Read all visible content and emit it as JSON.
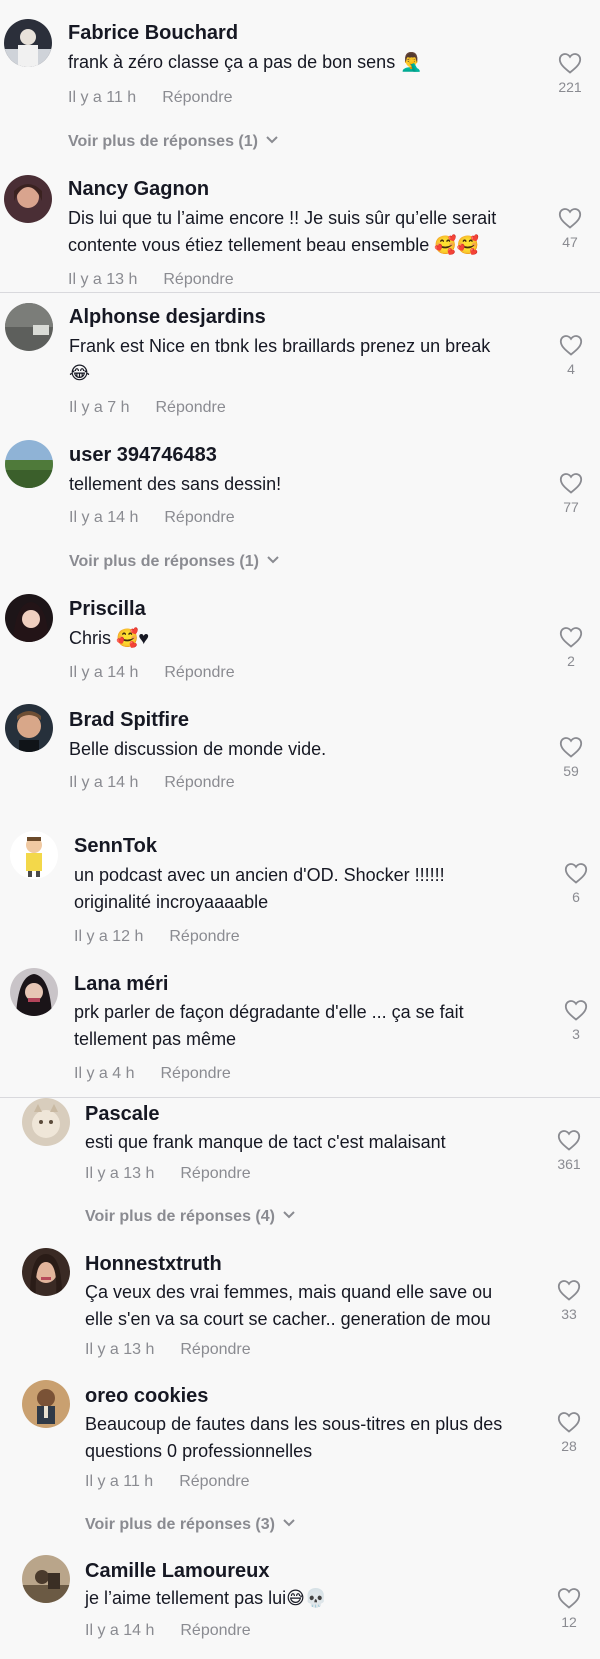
{
  "comments": [
    {
      "name": "Fabrice Bouchard",
      "line1": "frank à zéro classe ça a pas de bon sens 🤦‍♂️",
      "line2": "",
      "time": "Il y a 11 h",
      "reply": "Répondre",
      "likes": "221",
      "more": "Voir plus de réponses (1)"
    },
    {
      "name": "Nancy Gagnon",
      "line1": "Dis lui que tu l’aime encore !! Je suis sûr qu’elle serait",
      "line2": "contente vous étiez tellement beau ensemble 🥰🥰",
      "time": "Il y a 13 h",
      "reply": "Répondre",
      "likes": "47"
    },
    {
      "name": "Alphonse desjardins",
      "line1": "Frank est Nice en tbnk les braillards prenez un break",
      "line2": "😂",
      "time": "Il y a 7 h",
      "reply": "Répondre",
      "likes": "4"
    },
    {
      "name": "user 394746483",
      "line1": "tellement des sans dessin!",
      "line2": "",
      "time": "Il y a 14 h",
      "reply": "Répondre",
      "likes": "77",
      "more": "Voir plus de réponses (1)"
    },
    {
      "name": "Priscilla",
      "line1": "Chris 🥰♥",
      "line2": "",
      "time": "Il y a 14 h",
      "reply": "Répondre",
      "likes": "2"
    },
    {
      "name": "Brad Spitfire",
      "line1": "Belle discussion de monde vide.",
      "line2": "",
      "time": "Il y a 14 h",
      "reply": "Répondre",
      "likes": "59"
    },
    {
      "name": "SennTok",
      "line1": "un podcast avec un ancien d'OD. Shocker !!!!!!",
      "line2": "originalité incroyaaaable",
      "time": "Il y a 12 h",
      "reply": "Répondre",
      "likes": "6"
    },
    {
      "name": "Lana méri",
      "line1": "prk parler de façon dégradante d'elle ... ça se fait",
      "line2": "tellement pas même",
      "time": "Il y a 4 h",
      "reply": "Répondre",
      "likes": "3"
    },
    {
      "name": "Pascale",
      "line1": "esti que frank manque de tact c'est malaisant",
      "line2": "",
      "time": "Il y a 13 h",
      "reply": "Répondre",
      "likes": "361",
      "more": "Voir plus de réponses (4)"
    },
    {
      "name": "Honnestxtruth",
      "line1": "Ça veux des vrai femmes, mais quand elle save ou",
      "line2": "elle s'en va sa court se cacher.. generation de mou",
      "time": "Il y a 13 h",
      "reply": "Répondre",
      "likes": "33"
    },
    {
      "name": "oreo cookies",
      "line1": "Beaucoup de fautes dans les sous-titres en plus des",
      "line2": "questions 0 professionnelles",
      "time": "Il y a 11 h",
      "reply": "Répondre",
      "likes": "28",
      "more": "Voir plus de réponses (3)"
    },
    {
      "name": "Camille Lamoureux",
      "line1": "je l’aime tellement pas lui😅💀",
      "line2": "",
      "time": "Il y a 14 h",
      "reply": "Répondre",
      "likes": "12"
    }
  ],
  "icons": {
    "like": "heart-outline-icon",
    "expand": "chevron-down-icon"
  },
  "colors": {
    "background": "#f8f8f8",
    "name": "#161823",
    "meta": "#8a8b91",
    "divider": "#d9d9dd"
  }
}
